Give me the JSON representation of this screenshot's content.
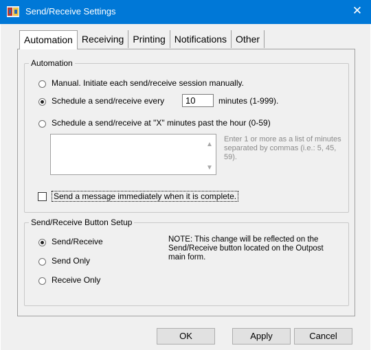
{
  "window": {
    "title": "Send/Receive Settings",
    "close_glyph": "✕"
  },
  "tabs": [
    {
      "label": "Automation",
      "active": true
    },
    {
      "label": "Receiving",
      "active": false
    },
    {
      "label": "Printing",
      "active": false
    },
    {
      "label": "Notifications",
      "active": false
    },
    {
      "label": "Other",
      "active": false
    }
  ],
  "automation": {
    "legend": "Automation",
    "manual_label": "Manual.  Initiate each send/receive session manually.",
    "schedule_every_label": "Schedule a send/receive every",
    "schedule_every_value": "10",
    "schedule_every_suffix": "minutes (1-999).",
    "schedule_past_label": "Schedule a send/receive at \"X\" minutes past the hour (0-59)",
    "minutes_list_value": "",
    "minutes_hint": "Enter 1 or more as a list of minutes separated by commas (i.e.: 5, 45, 59).",
    "selected": "schedule_every",
    "send_immediately_label": "Send a message immediately when it is complete.",
    "send_immediately_checked": false
  },
  "button_setup": {
    "legend": "Send/Receive Button Setup",
    "options": [
      "Send/Receive",
      "Send Only",
      "Receive Only"
    ],
    "selected": "Send/Receive",
    "note": "NOTE:  This change will be reflected on the Send/Receive button located on the Outpost main form."
  },
  "footer": {
    "ok": "OK",
    "apply": "Apply",
    "cancel": "Cancel"
  },
  "colors": {
    "titlebar": "#0078d7",
    "dialog_bg": "#f0f0f0",
    "hint_text": "#8a8a8a"
  },
  "icons": {
    "app": "outpost-app-icon",
    "close": "close-icon",
    "scroll_up": "scroll-up-icon",
    "scroll_down": "scroll-down-icon"
  }
}
